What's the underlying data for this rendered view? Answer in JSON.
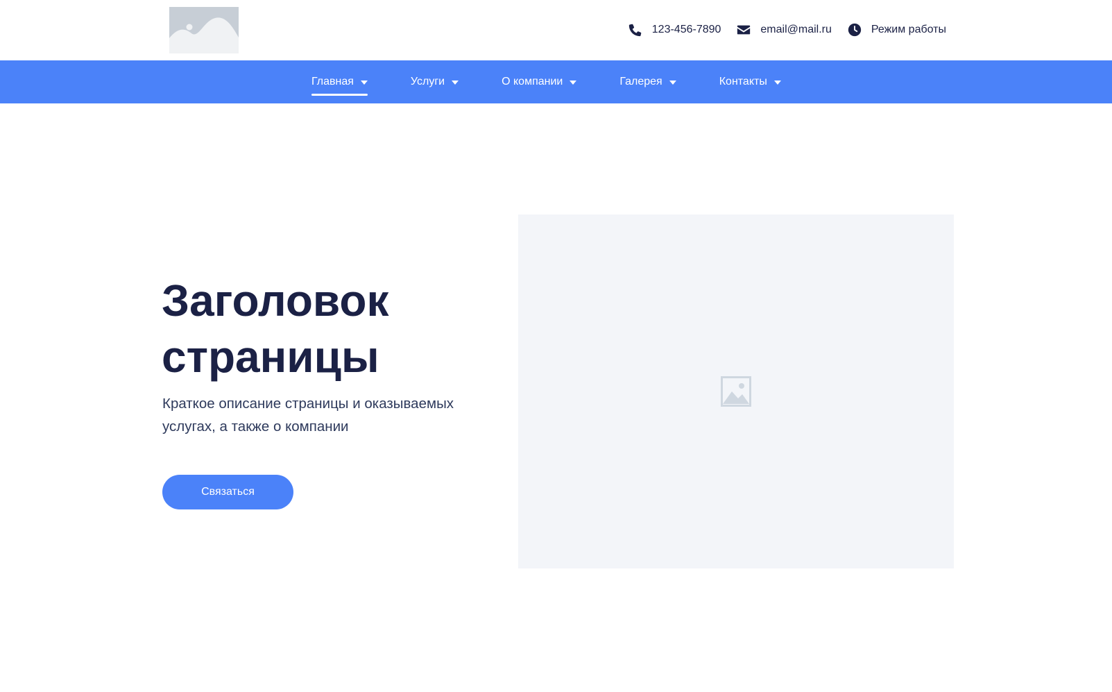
{
  "header": {
    "logo_icon": "image-placeholder-icon",
    "phone": {
      "icon": "phone-icon",
      "text": "123-456-7890"
    },
    "email": {
      "icon": "envelope-icon",
      "text": "email@mail.ru"
    },
    "hours": {
      "icon": "clock-icon",
      "text": "Режим работы"
    }
  },
  "nav": {
    "items": [
      {
        "label": "Главная",
        "active": true
      },
      {
        "label": "Услуги"
      },
      {
        "label": "О компании"
      },
      {
        "label": "Галерея"
      },
      {
        "label": "Контакты"
      }
    ]
  },
  "hero": {
    "title_line1": "Заголовок",
    "title_line2": "страницы",
    "description": "Краткое описание страницы и оказываемых услугах, а также о компании",
    "cta_label": "Связаться",
    "image_icon": "image-placeholder-icon"
  },
  "colors": {
    "accent": "#4b82f9",
    "text_dark": "#1b2145",
    "placeholder_bg": "#f3f5f9"
  }
}
